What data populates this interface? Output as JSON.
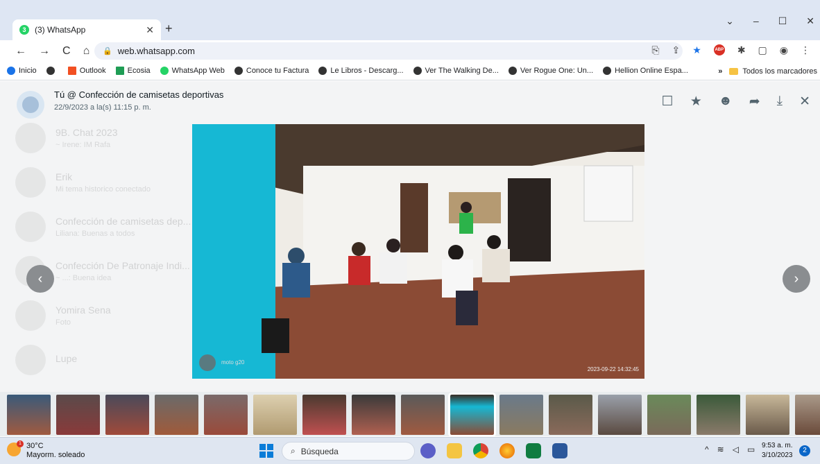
{
  "browser": {
    "tab_title": "(3) WhatsApp",
    "tab_badge": "3",
    "url": "web.whatsapp.com",
    "bookmarks": [
      "Inicio",
      "Outlook",
      "Ecosia",
      "WhatsApp Web",
      "Conoce tu Factura",
      "Le Libros - Descarg...",
      "Ver The Walking De...",
      "Ver Rogue One: Un...",
      "Hellion Online Espa..."
    ],
    "bookmarks_overflow": "»",
    "all_bookmarks": "Todos los marcadores"
  },
  "viewer": {
    "title": "Tú @ Confección de camisetas deportivas",
    "date": "22/9/2023 a la(s) 11:15 p. m.",
    "photo_watermark": "moto g20",
    "photo_timestamp": "2023-09-22  14:32:45"
  },
  "background_chats": [
    {
      "name": "9B. Chat 2023",
      "snippet": "~ Irene: IM Rafa"
    },
    {
      "name": "Erik",
      "snippet": "Mi tema historico conectado"
    },
    {
      "name": "Confección de camisetas dep...",
      "snippet": "Liliana: Buenas a todos"
    },
    {
      "name": "Confección De Patronaje Indi...",
      "snippet": "~ ...: Buena idea"
    },
    {
      "name": "Yomira Sena",
      "snippet": "Foto"
    },
    {
      "name": "Lupe",
      "snippet": ""
    }
  ],
  "taskbar": {
    "temperature": "30°C",
    "weather": "Mayorm. soleado",
    "weather_badge": "1",
    "search_placeholder": "Búsqueda",
    "time": "9:53 a. m.",
    "date": "3/10/2023",
    "notifications": "2"
  }
}
